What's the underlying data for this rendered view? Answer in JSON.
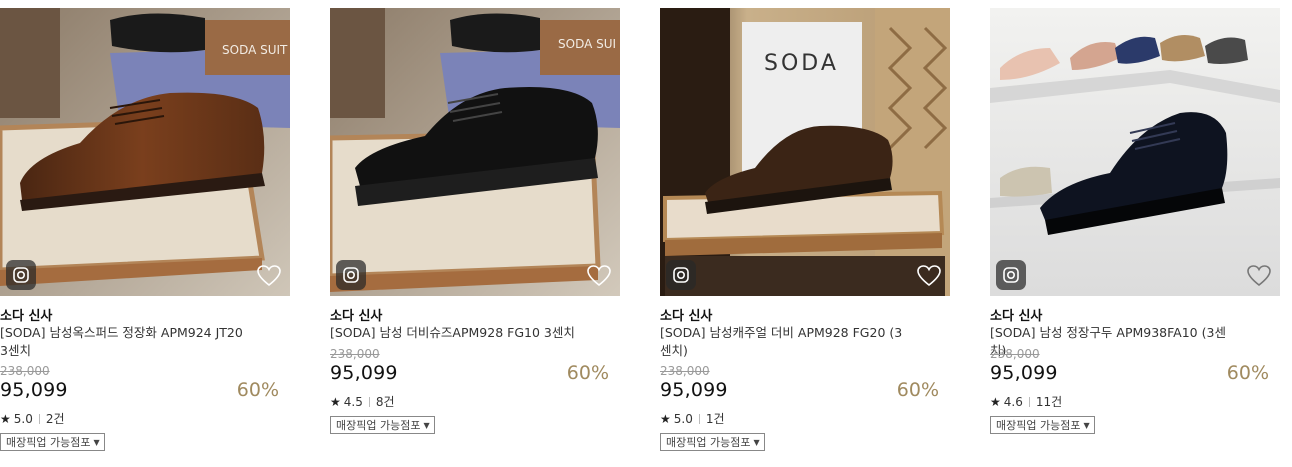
{
  "products": [
    {
      "brand": "소다 신사",
      "name": "[SODA] 남성옥스퍼드 정장화 APM924 JT20 3센치",
      "original_price": "238,000",
      "price": "95,099",
      "discount": "60%",
      "rating": "5.0",
      "review_count": "2건",
      "pickup_label": "매장픽업 가능점포",
      "display_sign": "SODA SUIT"
    },
    {
      "brand": "소다 신사",
      "name": "[SODA] 남성 더비슈즈APM928 FG10 3센치",
      "original_price": "238,000",
      "price": "95,099",
      "discount": "60%",
      "rating": "4.5",
      "review_count": "8건",
      "pickup_label": "매장픽업 가능점포",
      "display_sign": "SODA SUI"
    },
    {
      "brand": "소다 신사",
      "name": "[SODA] 남성캐주얼 더비 APM928 FG20 (3센치)",
      "original_price": "238,000",
      "price": "95,099",
      "discount": "60%",
      "rating": "5.0",
      "review_count": "1건",
      "pickup_label": "매장픽업 가능점포",
      "display_sign": "SODA"
    },
    {
      "brand": "소다 신사",
      "name": "[SODA] 남성 정장구두 APM938FA10 (3센치)",
      "original_price": "238,000",
      "price": "95,099",
      "discount": "60%",
      "rating": "4.6",
      "review_count": "11건",
      "pickup_label": "매장픽업 가능점포"
    }
  ]
}
